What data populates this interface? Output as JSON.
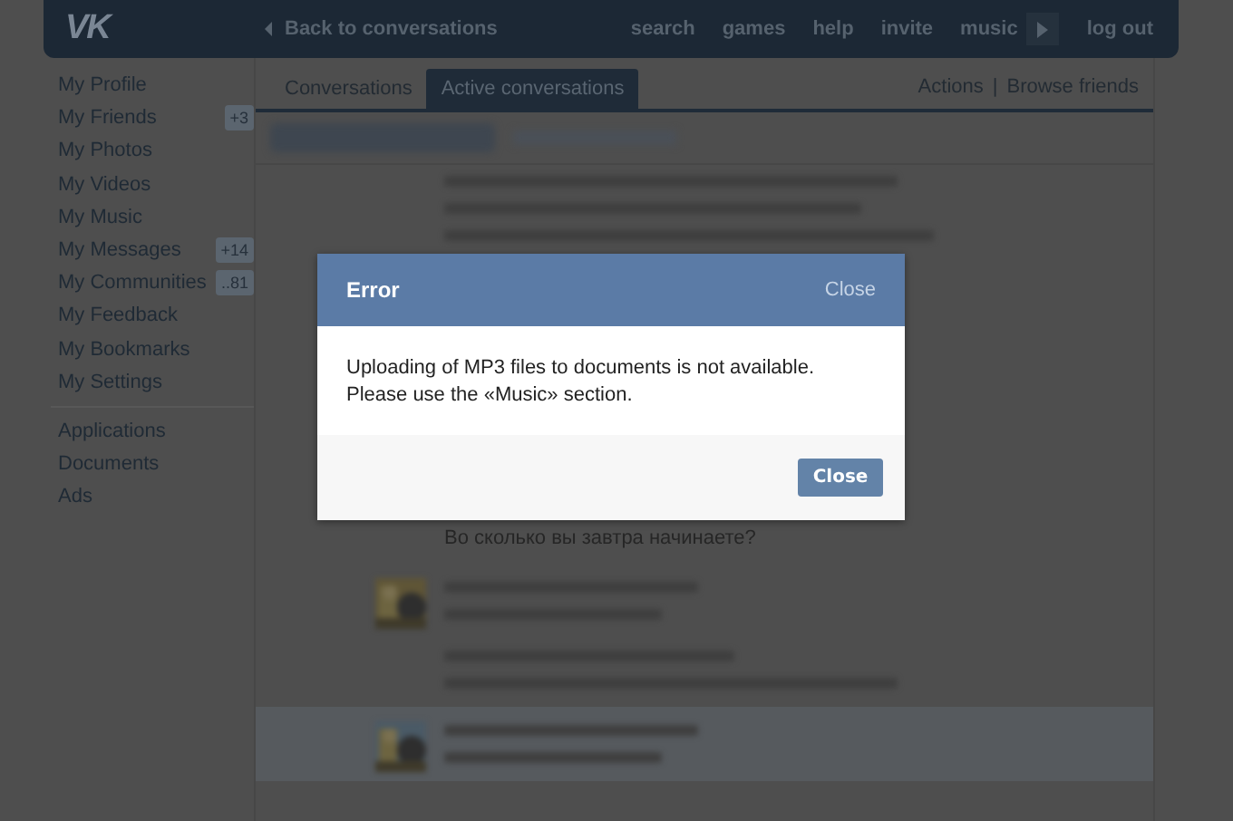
{
  "header": {
    "logo": "VK",
    "back_link": "Back to conversations",
    "nav": [
      "search",
      "games",
      "help",
      "invite",
      "music"
    ],
    "logout": "log out"
  },
  "sidebar": {
    "groups": [
      [
        {
          "label": "My Profile"
        },
        {
          "label": "My Friends",
          "badge": "+3"
        },
        {
          "label": "My Photos"
        },
        {
          "label": "My Videos"
        },
        {
          "label": "My Music"
        },
        {
          "label": "My Messages",
          "badge": "+14"
        },
        {
          "label": "My Communities",
          "badge": "..81"
        },
        {
          "label": "My Feedback"
        },
        {
          "label": "My Bookmarks"
        },
        {
          "label": "My Settings"
        }
      ],
      [
        {
          "label": "Applications"
        },
        {
          "label": "Documents"
        },
        {
          "label": "Ads"
        }
      ]
    ]
  },
  "tabs": [
    {
      "label": "Conversations",
      "selected": false
    },
    {
      "label": "Active conversations",
      "selected": true
    }
  ],
  "actions": [
    "Actions",
    "Browse friends"
  ],
  "actions_separator": "|",
  "messages": [
    {
      "kind": "blurred"
    },
    {
      "kind": "text",
      "text": "Во сколько вы завтра начинаете?"
    },
    {
      "kind": "blurred",
      "avatar": true
    },
    {
      "kind": "blurred",
      "avatar": true,
      "highlighted": true
    }
  ],
  "dialog": {
    "title": "Error",
    "header_close": "Close",
    "lines": [
      "Uploading of MP3 files to documents is not available.",
      "Please use the «Music» section."
    ],
    "button": "Close"
  }
}
